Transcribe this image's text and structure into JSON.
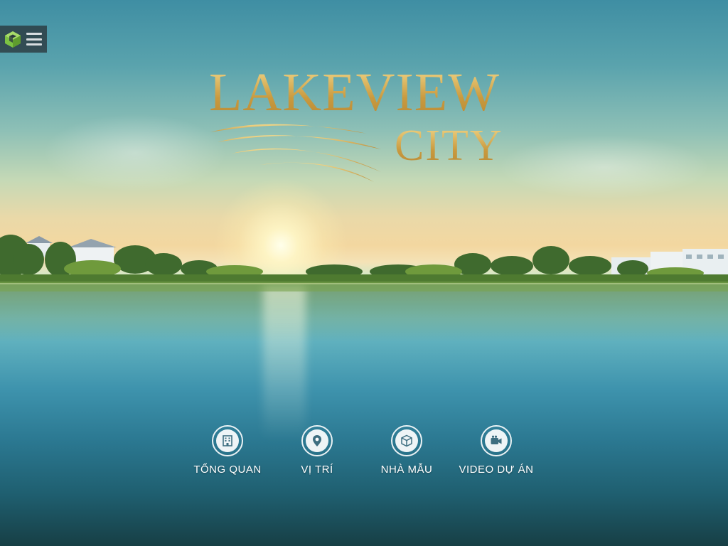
{
  "logo": {
    "word1": "LAKEVIEW",
    "word2": "CITY"
  },
  "menu": {
    "logo_icon": "cube-icon",
    "menu_icon": "hamburger-icon",
    "logo_color": "#7cc243"
  },
  "nav": [
    {
      "label": "TỔNG QUAN",
      "icon": "building-icon"
    },
    {
      "label": "VỊ TRÍ",
      "icon": "map-pin-icon"
    },
    {
      "label": "NHÀ MẪU",
      "icon": "cube-icon"
    },
    {
      "label": "VIDEO DỰ ÁN",
      "icon": "video-camera-icon"
    }
  ],
  "colors": {
    "gold": "#d9b25c",
    "nav_icon": "#3d6e80"
  }
}
